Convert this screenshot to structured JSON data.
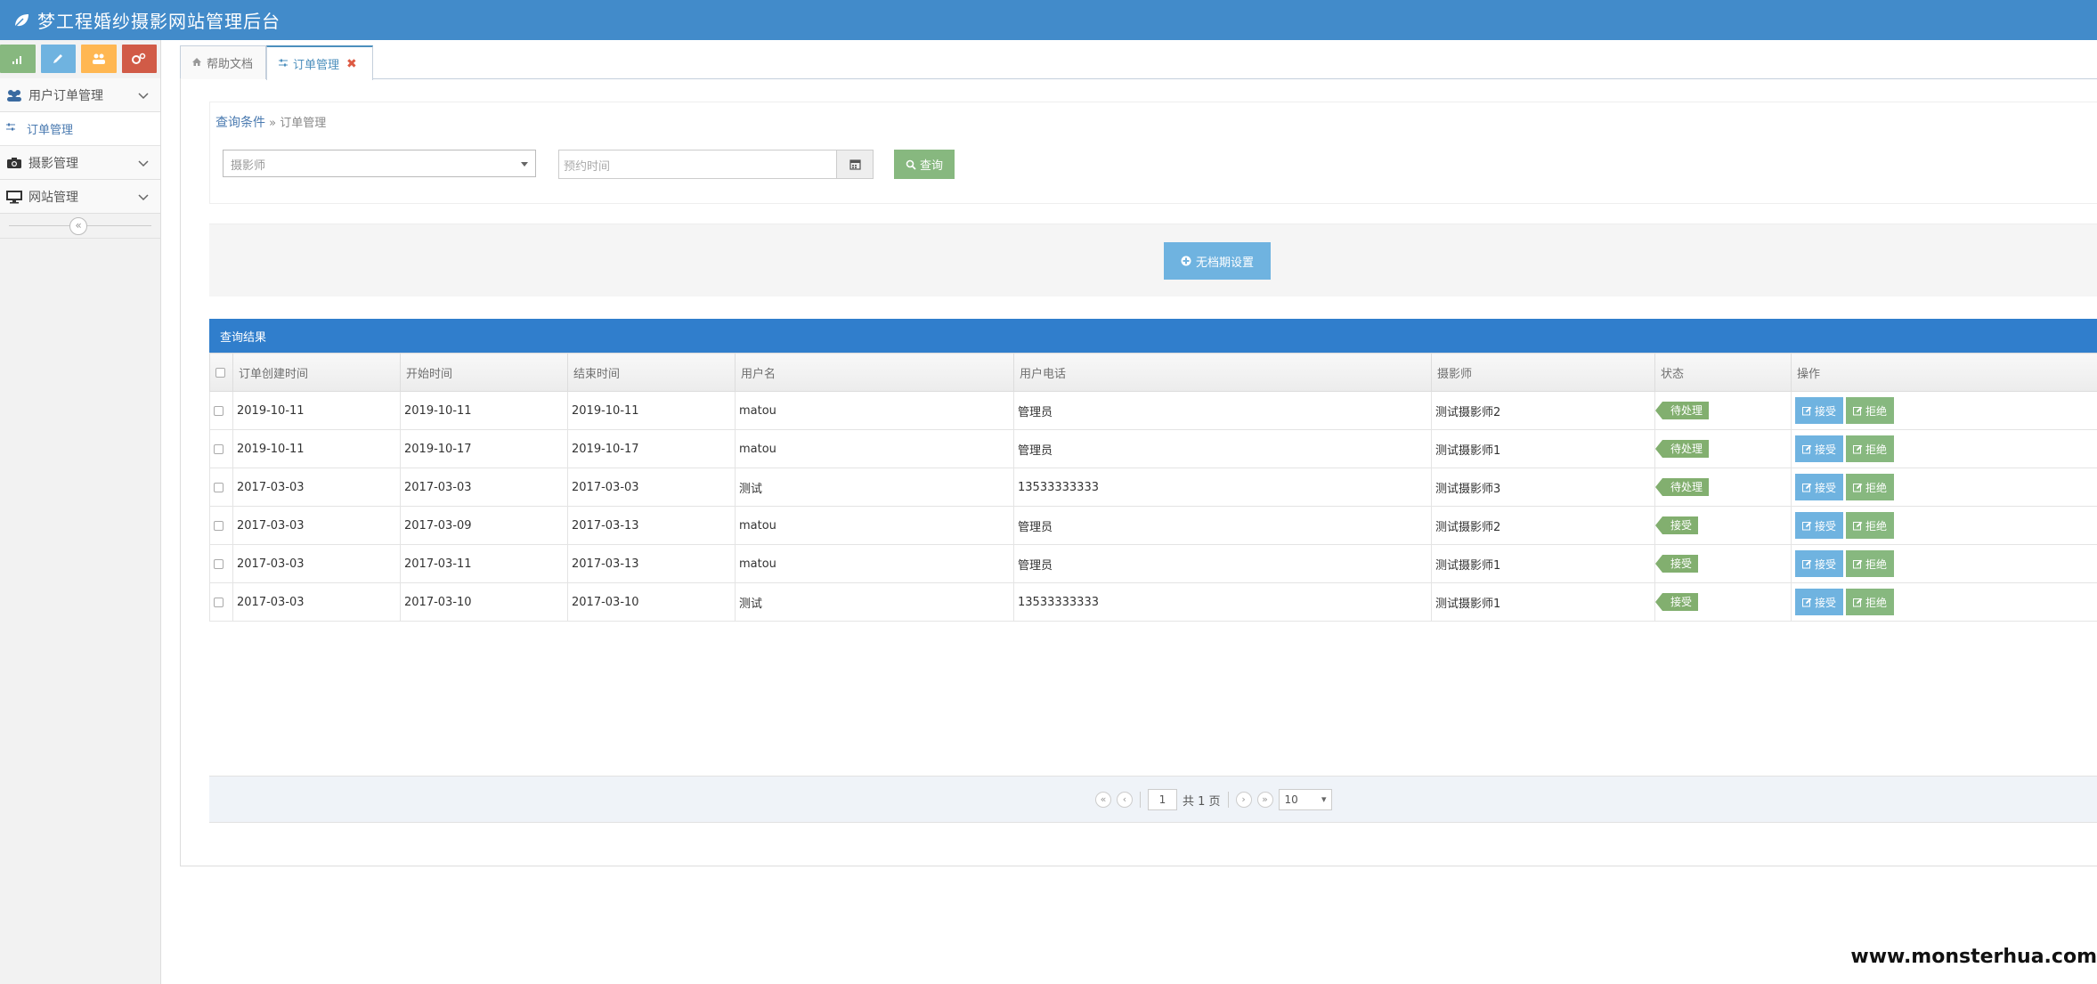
{
  "app": {
    "title": "梦工程婚纱摄影网站管理后台",
    "brand_color": "#428bca"
  },
  "sidebar": {
    "shortcuts": [
      {
        "name": "signal-icon",
        "color": "#87b87f"
      },
      {
        "name": "pencil-icon",
        "color": "#6fb3e0"
      },
      {
        "name": "users-icon",
        "color": "#ffb752"
      },
      {
        "name": "cogs-icon",
        "color": "#d15b47"
      }
    ],
    "menu": [
      {
        "label": "用户订单管理",
        "icon": "users-icon"
      },
      {
        "label": "订单管理",
        "icon": "sliders-icon"
      },
      {
        "label": "摄影管理",
        "icon": "camera-icon"
      },
      {
        "label": "网站管理",
        "icon": "desktop-icon"
      }
    ],
    "collapse_label": "«"
  },
  "tabs": [
    {
      "label": "帮助文档",
      "icon": "home-icon"
    },
    {
      "label": "订单管理",
      "icon": "sliders-icon",
      "close": "✖"
    }
  ],
  "query": {
    "breadcrumb_link": "查询条件",
    "breadcrumb_sep": "»",
    "breadcrumb_current": "订单管理",
    "photographer_select": "摄影师",
    "date_placeholder": "预约时间",
    "search_label": "查询"
  },
  "toolbar": {
    "no_schedule_label": "无档期设置"
  },
  "results": {
    "title": "查询结果",
    "columns": [
      "订单创建时间",
      "开始时间",
      "结束时间",
      "用户名",
      "用户电话",
      "摄影师",
      "状态",
      "操作"
    ],
    "rows": [
      {
        "created": "2019-10-11",
        "start": "2019-10-11",
        "end": "2019-10-11",
        "user": "matou",
        "phone": "管理员",
        "photographer": "测试摄影师2",
        "status": "待处理"
      },
      {
        "created": "2019-10-11",
        "start": "2019-10-17",
        "end": "2019-10-17",
        "user": "matou",
        "phone": "管理员",
        "photographer": "测试摄影师1",
        "status": "待处理"
      },
      {
        "created": "2017-03-03",
        "start": "2017-03-03",
        "end": "2017-03-03",
        "user": "测试",
        "phone": "13533333333",
        "photographer": "测试摄影师3",
        "status": "待处理"
      },
      {
        "created": "2017-03-03",
        "start": "2017-03-09",
        "end": "2017-03-13",
        "user": "matou",
        "phone": "管理员",
        "photographer": "测试摄影师2",
        "status": "接受"
      },
      {
        "created": "2017-03-03",
        "start": "2017-03-11",
        "end": "2017-03-13",
        "user": "matou",
        "phone": "管理员",
        "photographer": "测试摄影师1",
        "status": "接受"
      },
      {
        "created": "2017-03-03",
        "start": "2017-03-10",
        "end": "2017-03-10",
        "user": "测试",
        "phone": "13533333333",
        "photographer": "测试摄影师1",
        "status": "接受"
      }
    ],
    "accept_label": "接受",
    "reject_label": "拒绝"
  },
  "pager": {
    "page": "1",
    "total_text": "共 1 页",
    "page_size": "10"
  },
  "watermark": "www.monsterhua.com"
}
